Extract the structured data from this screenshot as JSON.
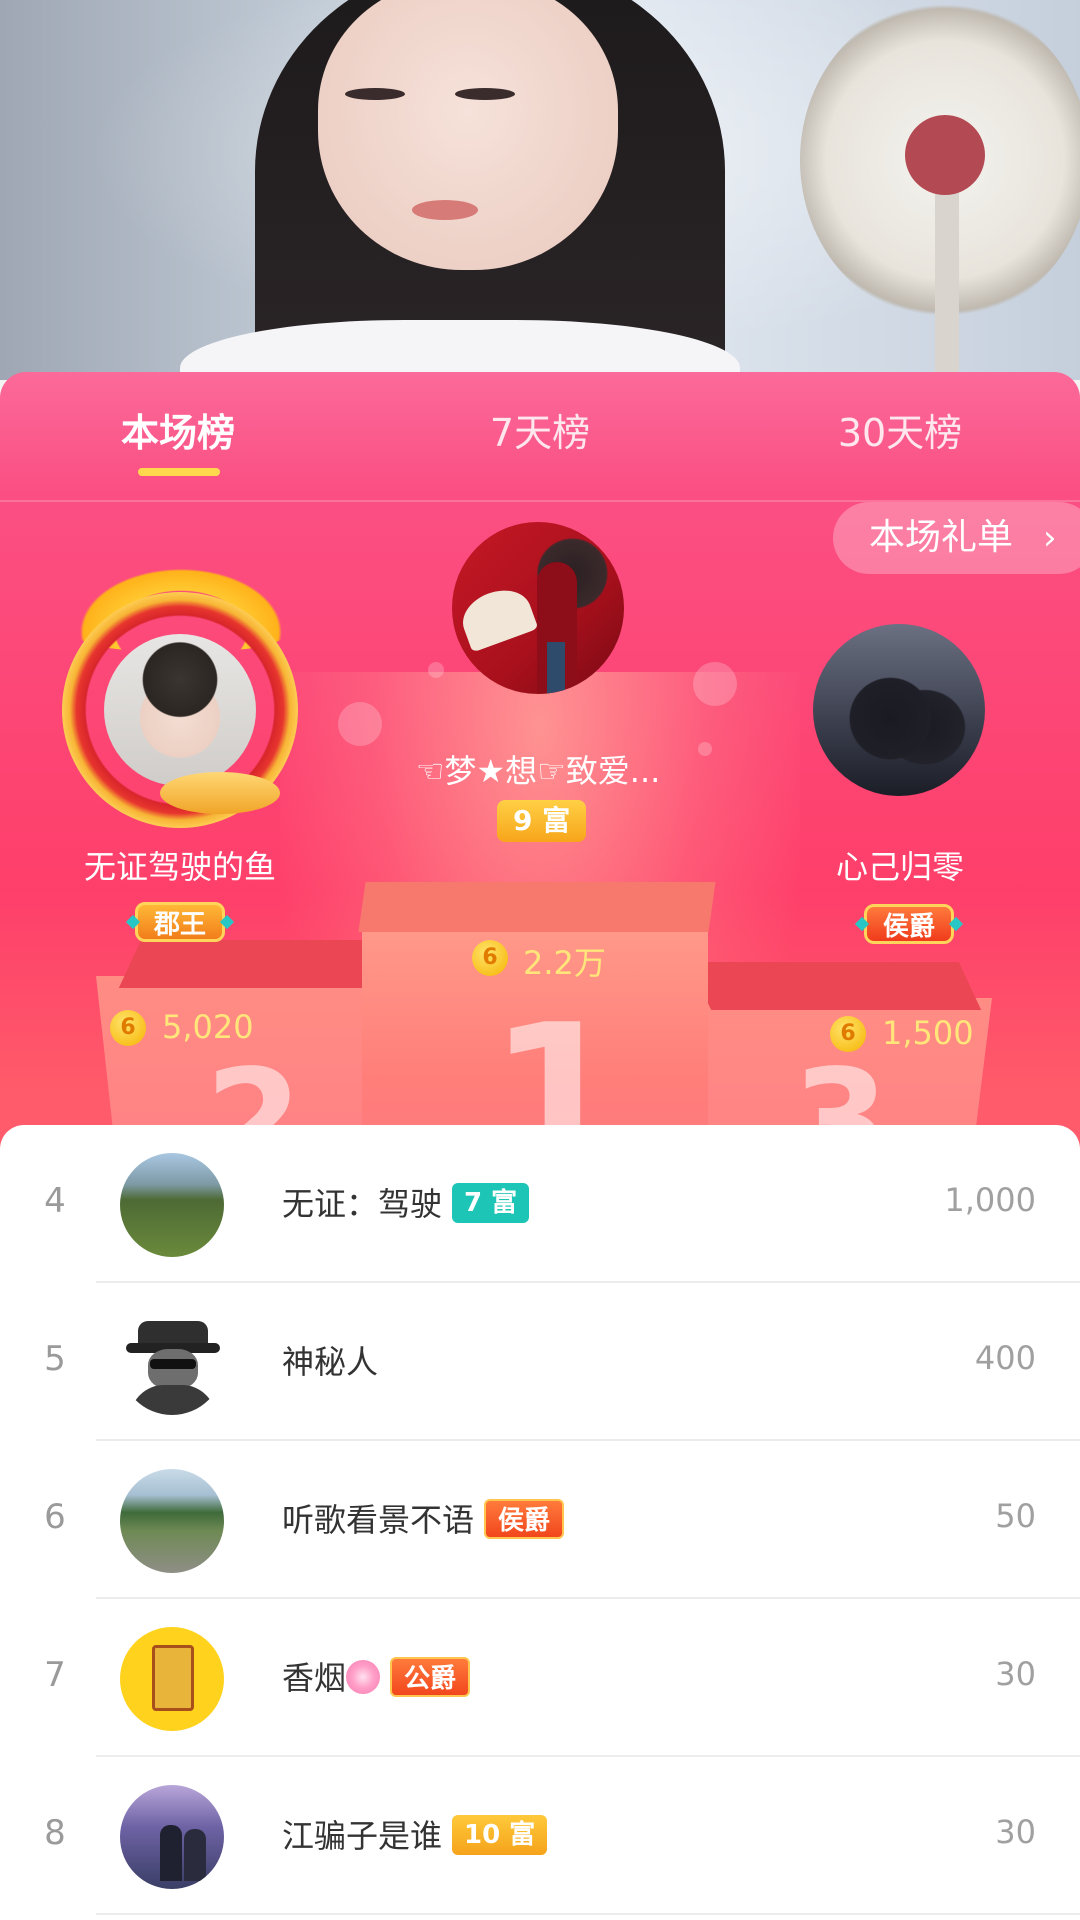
{
  "tabs": [
    {
      "label": "本场榜",
      "active": true
    },
    {
      "label": "7天榜",
      "active": false
    },
    {
      "label": "30天榜",
      "active": false
    }
  ],
  "gift_list_button": {
    "label": "本场礼单",
    "icon": "chevron-right-icon"
  },
  "podium": {
    "first": {
      "rank": "1",
      "name": "☜梦★想☞致爱...",
      "badge": "9 富",
      "score": "2.2万"
    },
    "second": {
      "rank": "2",
      "name": "无证驾驶的鱼",
      "badge": "郡王",
      "score": "5,020"
    },
    "third": {
      "rank": "3",
      "name": "心己归零",
      "badge": "侯爵",
      "score": "1,500"
    }
  },
  "coin_symbol": "6",
  "ranking_list": [
    {
      "rank": "4",
      "name": "无证：驾驶",
      "tag": "7 富",
      "score": "1,000"
    },
    {
      "rank": "5",
      "name": "神秘人",
      "tag": "",
      "score": "400"
    },
    {
      "rank": "6",
      "name": "听歌看景不语",
      "tag": "侯爵",
      "score": "50"
    },
    {
      "rank": "7",
      "name": "香烟",
      "tag": "公爵",
      "score": "30"
    },
    {
      "rank": "8",
      "name": "江骗子是谁",
      "tag": "10 富",
      "score": "30"
    }
  ],
  "colors": {
    "accent": "#fe3f6a",
    "tab_indicator": "#ffd84e",
    "coin": "#f5b300",
    "rich_badge": "#f7a51b",
    "teal_badge": "#1cc5b5"
  }
}
